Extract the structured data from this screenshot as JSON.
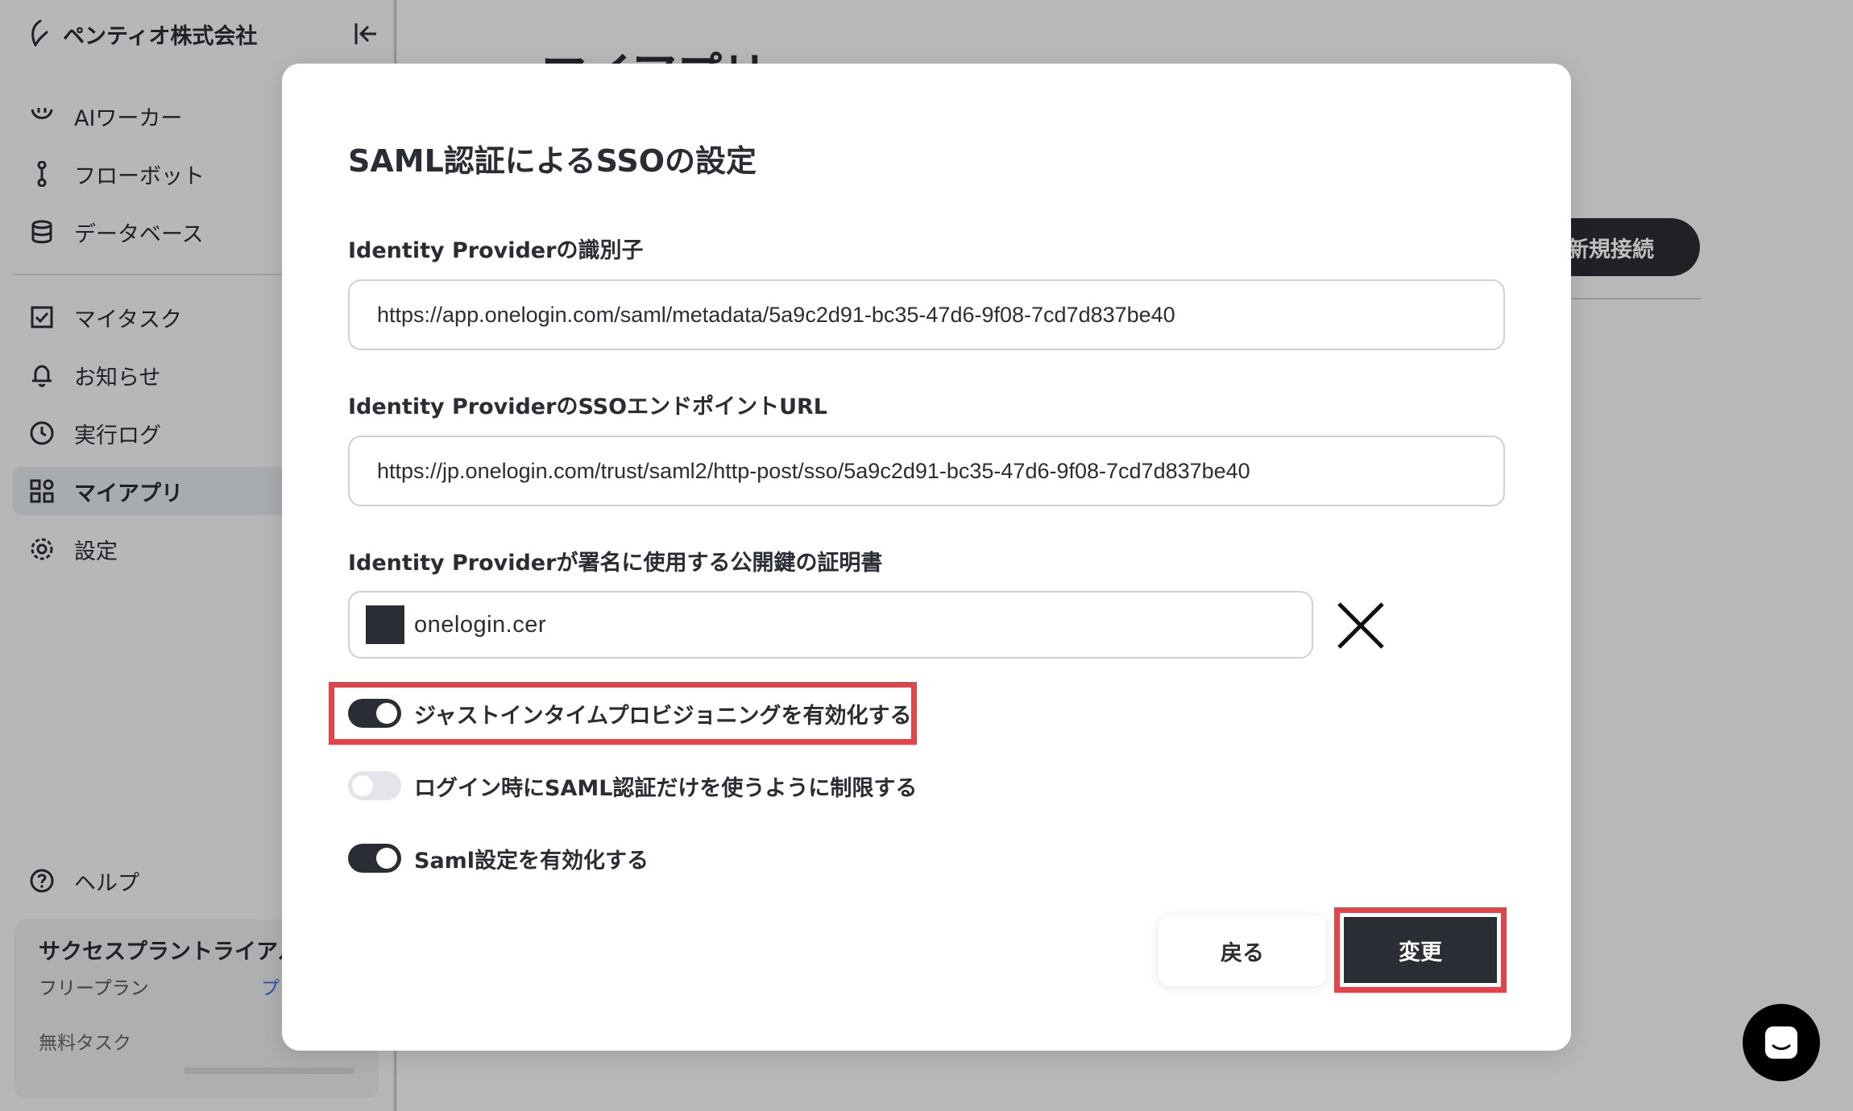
{
  "sidebar": {
    "org_name": "ペンティオ株式会社",
    "nav_top": [
      {
        "label": "AIワーカー",
        "icon": "smile-icon"
      },
      {
        "label": "フローボット",
        "icon": "flow-icon"
      },
      {
        "label": "データベース",
        "icon": "database-icon"
      }
    ],
    "nav_bottom": [
      {
        "label": "マイタスク",
        "icon": "checkbox-icon"
      },
      {
        "label": "お知らせ",
        "icon": "bell-icon"
      },
      {
        "label": "実行ログ",
        "icon": "clock-icon"
      },
      {
        "label": "マイアプリ",
        "icon": "apps-icon",
        "active": true
      },
      {
        "label": "設定",
        "icon": "gear-icon"
      }
    ],
    "help_label": "ヘルプ",
    "plan": {
      "title": "サクセスプラントライアル",
      "subtitle": "フリープラン",
      "link": "プ",
      "task_label": "無料タスク"
    }
  },
  "main": {
    "page_title": "マイアプリ",
    "new_connection_label": "新規接続"
  },
  "modal": {
    "title": "SAML認証によるSSOの設定",
    "idp_identifier": {
      "label": "Identity Providerの識別子",
      "value": "https://app.onelogin.com/saml/metadata/5a9c2d91-bc35-47d6-9f08-7cd7d837be40"
    },
    "idp_sso_url": {
      "label": "Identity ProviderのSSOエンドポイントURL",
      "value": "https://jp.onelogin.com/trust/saml2/http-post/sso/5a9c2d91-bc35-47d6-9f08-7cd7d837be40"
    },
    "idp_certificate": {
      "label": "Identity Providerが署名に使用する公開鍵の証明書",
      "file_name": "onelogin.cer"
    },
    "toggles": [
      {
        "label": "ジャストインタイムプロビジョニングを有効化する",
        "on": true
      },
      {
        "label": "ログイン時にSAML認証だけを使うように制限する",
        "on": false
      },
      {
        "label": "Saml設定を有効化する",
        "on": true
      }
    ],
    "back_label": "戻る",
    "submit_label": "変更"
  },
  "colors": {
    "dark": "#2a2d33",
    "highlight": "#e3444a",
    "toggle_off": "#e3e5ea"
  }
}
